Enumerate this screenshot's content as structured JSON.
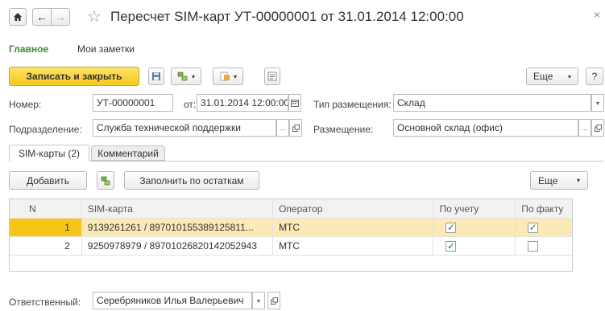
{
  "title": "Пересчет SIM-карт УТ-00000001 от 31.01.2014 12:00:00",
  "close_glyph": "×",
  "nav": {
    "main": "Главное",
    "notes": "Мои заметки"
  },
  "toolbar": {
    "save_close": "Записать и закрыть",
    "more": "Еще",
    "help": "?"
  },
  "form": {
    "number_label": "Номер:",
    "number_value": "УТ-00000001",
    "from_label": "от:",
    "date_value": "31.01.2014 12:00:00",
    "placement_type_label": "Тип размещения:",
    "placement_type_value": "Склад",
    "division_label": "Подразделение:",
    "division_value": "Служба технической поддержки",
    "placement_label": "Размещение:",
    "placement_value": "Основной склад (офис)"
  },
  "tabs": [
    {
      "label": "SIM-карты (2)",
      "active": true
    },
    {
      "label": "Комментарий",
      "active": false
    }
  ],
  "table_toolbar": {
    "add": "Добавить",
    "fill": "Заполнить по остаткам",
    "more": "Еще"
  },
  "table": {
    "columns": [
      "N",
      "SIM-карта",
      "Оператор",
      "По учету",
      "По факту"
    ],
    "rows": [
      {
        "n": "1",
        "sim": "9139261261 / 897010155389125811...",
        "operator": "МТС",
        "accounted": true,
        "actual": true
      },
      {
        "n": "2",
        "sim": "9250978979 / 89701026820142052943",
        "operator": "МТС",
        "accounted": true,
        "actual": false
      }
    ]
  },
  "responsible": {
    "label": "Ответственный:",
    "value": "Серебряников Илья Валерьевич"
  },
  "colors": {
    "accent_green": "#3a8a2e",
    "primary_button": "#f5c81a",
    "selected_row": "#fbeab7"
  }
}
